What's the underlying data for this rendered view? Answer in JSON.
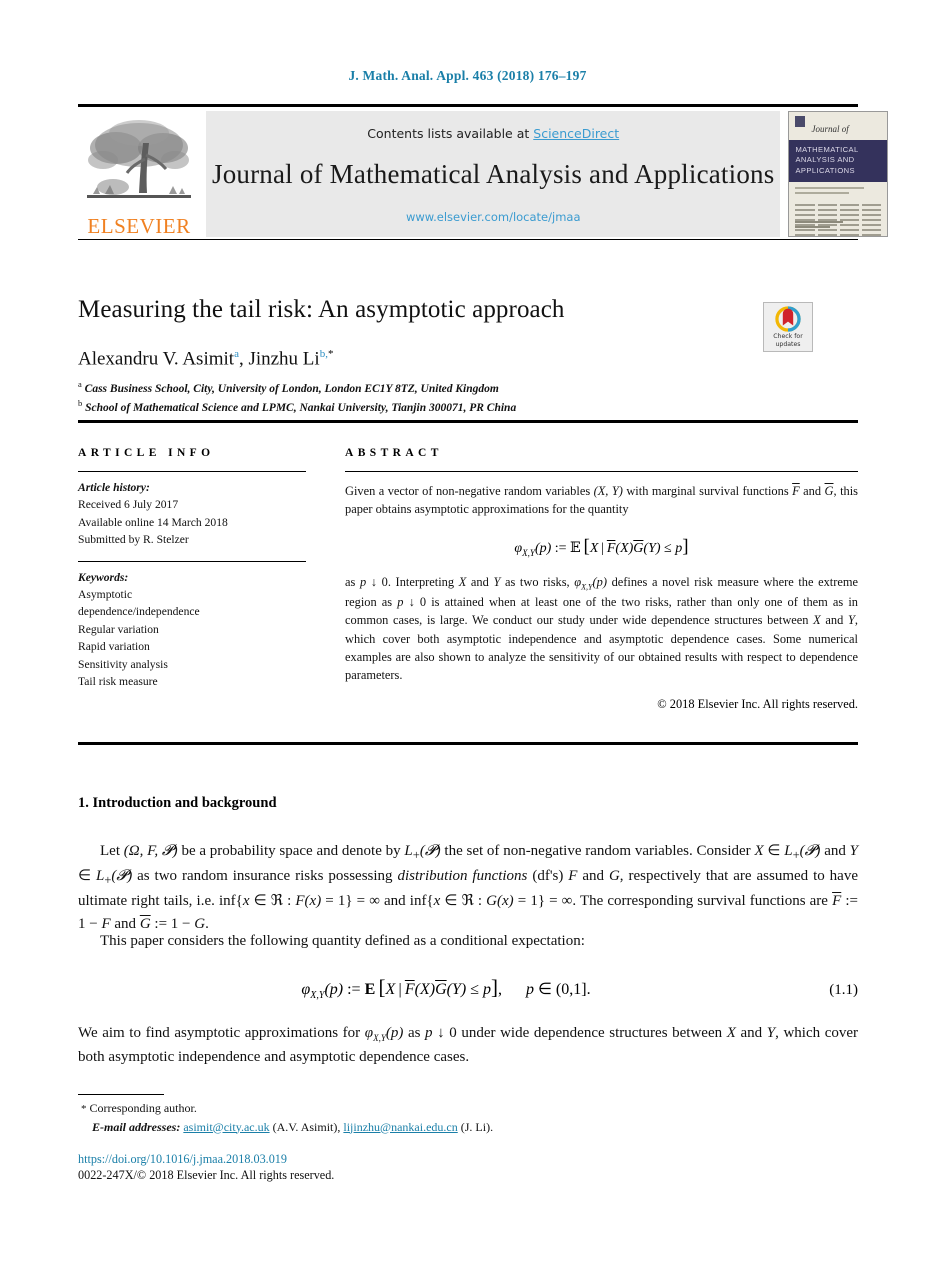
{
  "running_head": "J. Math. Anal. Appl. 463 (2018) 176–197",
  "masthead": {
    "contents_prefix": "Contents lists available at ",
    "sciencedirect": "ScienceDirect",
    "journal_name": "Journal of Mathematical Analysis and Applications",
    "journal_url": "www.elsevier.com/locate/jmaa",
    "publisher": "ELSEVIER",
    "cover": {
      "journal_of": "Journal of",
      "title_line1": "MATHEMATICAL",
      "title_line2": "ANALYSIS AND",
      "title_line3": "APPLICATIONS"
    }
  },
  "crossmark": {
    "line1": "Check for",
    "line2": "updates"
  },
  "article": {
    "title": "Measuring the tail risk: An asymptotic approach",
    "authors": "Alexandru V. Asimit, Jinzhu Li",
    "author_1": "Alexandru V. Asimit",
    "author_1_mark": "a",
    "author_2": "Jinzhu Li",
    "author_2_mark": "b,",
    "author_2_star": "*",
    "affiliation_a_mark": "a",
    "affiliation_a": "Cass Business School, City, University of London, London EC1Y 8TZ, United Kingdom",
    "affiliation_b_mark": "b",
    "affiliation_b": "School of Mathematical Science and LPMC, Nankai University, Tianjin 300071, PR China"
  },
  "info": {
    "heading": "ARTICLE INFO",
    "history_label": "Article history:",
    "history": [
      "Received 6 July 2017",
      "Available online 14 March 2018",
      "Submitted by R. Stelzer"
    ],
    "keywords_label": "Keywords:",
    "keywords": [
      "Asymptotic",
      "dependence/independence",
      "Regular variation",
      "Rapid variation",
      "Sensitivity analysis",
      "Tail risk measure"
    ]
  },
  "abstract": {
    "heading": "ABSTRACT",
    "para1": "Given a vector of non-negative random variables (X, Y) with marginal survival functions F̄ and Ḡ, this paper obtains asymptotic approximations for the quantity",
    "equation": "φ_{X,Y}(p) := E[X | F̄(X)Ḡ(Y) ≤ p]",
    "para2": "as p ↓ 0. Interpreting X and Y as two risks, φ_{X,Y}(p) defines a novel risk measure where the extreme region as p ↓ 0 is attained when at least one of the two risks, rather than only one of them as in common cases, is large. We conduct our study under wide dependence structures between X and Y, which cover both asymptotic independence and asymptotic dependence cases. Some numerical examples are also shown to analyze the sensitivity of our obtained results with respect to dependence parameters.",
    "copyright": "© 2018 Elsevier Inc. All rights reserved."
  },
  "section": {
    "number_title": "1. Introduction and background",
    "para1": "Let (Ω, F, P) be a probability space and denote by L₊(P) the set of non-negative random variables. Consider X ∈ L₊(P) and Y ∈ L₊(P) as two random insurance risks possessing distribution functions (df's) F and G, respectively that are assumed to have ultimate right tails, i.e. inf{x ∈ ℜ : F(x) = 1} = ∞ and inf{x ∈ ℜ : G(x) = 1} = ∞. The corresponding survival functions are F̄ := 1 − F and Ḡ := 1 − G.",
    "para2": "This paper considers the following quantity defined as a conditional expectation:",
    "equation": "φ_{X,Y}(p) := E[X | F̄(X)Ḡ(Y) ≤ p],   p ∈ (0,1].",
    "equation_number": "(1.1)",
    "para3": "We aim to find asymptotic approximations for φ_{X,Y}(p) as p ↓ 0 under wide dependence structures between X and Y, which cover both asymptotic independence and asymptotic dependence cases."
  },
  "footnote": {
    "star": "*",
    "corresponding": "Corresponding author.",
    "email_label": "E-mail addresses:",
    "email_1": "asimit@city.ac.uk",
    "email_1_owner": "(A.V. Asimit),",
    "email_2": "lijinzhu@nankai.edu.cn",
    "email_2_owner": "(J. Li).",
    "doi": "https://doi.org/10.1016/j.jmaa.2018.03.019",
    "issn_line": "0022-247X/© 2018 Elsevier Inc. All rights reserved."
  },
  "colors": {
    "link": "#1a7fa8",
    "sciencedirect": "#3a9bd0",
    "elsevier_orange": "#f08122",
    "cover_band": "#34325c"
  }
}
